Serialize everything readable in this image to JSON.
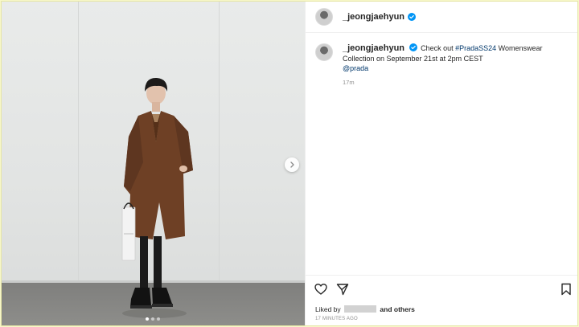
{
  "post": {
    "username": "_jeongjaehyun",
    "caption": {
      "text_before": "Check out ",
      "hashtag": "#PradaSS24",
      "text_middle": " Womenswear Collection on September 21st at 2pm CEST",
      "mention": "@prada"
    },
    "caption_time": "17m",
    "liked_by_prefix": "Liked by",
    "liked_by_suffix": "and others",
    "posted_ago": "17 MINUTES AGO"
  },
  "carousel": {
    "slide_count": 3,
    "active_index": 0
  },
  "icons": [
    "verified-badge-icon",
    "more-options-icon",
    "next-arrow-icon",
    "heart-icon",
    "share-icon",
    "bookmark-icon"
  ],
  "colors": {
    "link": "#00376b",
    "verified": "#0095f6",
    "muted": "#8e8e8e"
  }
}
